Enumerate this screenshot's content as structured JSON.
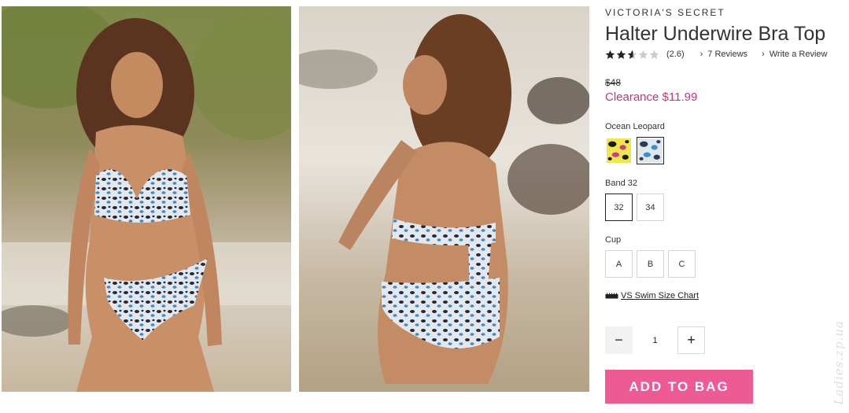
{
  "product": {
    "brand": "VICTORIA'S SECRET",
    "title": "Halter Underwire Bra Top",
    "rating": {
      "stars_filled": 2.6,
      "stars_total": 5,
      "value_text": "(2.6)",
      "reviews_link": "7 Reviews",
      "write_review_link": "Write a Review"
    },
    "price": {
      "original": "$48",
      "clearance": "Clearance $11.99"
    }
  },
  "color": {
    "label": "Ocean Leopard",
    "swatches": [
      {
        "name": "neon-leopard",
        "base": "#f0e84a",
        "spot": "#1a1a1a",
        "accent": "#d03a8c",
        "selected": false
      },
      {
        "name": "ocean-leopard",
        "base": "#dfe6ec",
        "spot": "#2a3a55",
        "accent": "#3a8fd0",
        "selected": true
      }
    ]
  },
  "band": {
    "label": "Band 32",
    "options": [
      "32",
      "34"
    ],
    "selected": "32"
  },
  "cup": {
    "label": "Cup",
    "options": [
      "A",
      "B",
      "C"
    ]
  },
  "size_chart": {
    "label": "VS Swim Size Chart",
    "icon": "ruler-icon"
  },
  "quantity": {
    "value": "1",
    "minus_icon": "minus-icon",
    "plus_icon": "plus-icon"
  },
  "cta": {
    "add_to_bag": "ADD TO BAG"
  },
  "watermark": "Ladies.zp.ua",
  "colors": {
    "clearance": "#c0367d",
    "cta_bg": "#ee5a93",
    "star": "#222222",
    "star_empty": "#cccccc"
  }
}
